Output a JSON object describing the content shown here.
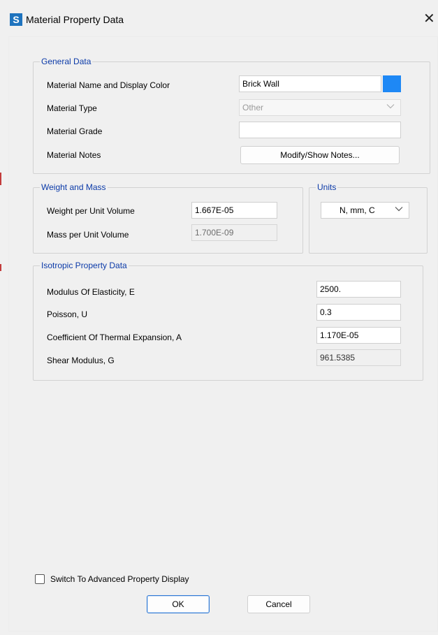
{
  "window": {
    "app_icon_letter": "S",
    "title": "Material Property Data",
    "close_glyph": "✕"
  },
  "general_data": {
    "legend": "General Data",
    "material_name_label": "Material Name and Display Color",
    "material_name_value": "Brick Wall",
    "display_color": "#1e88f5",
    "material_type_label": "Material Type",
    "material_type_value": "Other",
    "material_grade_label": "Material Grade",
    "material_grade_value": "",
    "material_notes_label": "Material Notes",
    "notes_button_label": "Modify/Show Notes..."
  },
  "weight_and_mass": {
    "legend": "Weight and Mass",
    "weight_label": "Weight per Unit Volume",
    "weight_value": "1.667E-05",
    "mass_label": "Mass per Unit Volume",
    "mass_value": "1.700E-09"
  },
  "units": {
    "legend": "Units",
    "value": "N, mm, C"
  },
  "isotropic": {
    "legend": "Isotropic Property Data",
    "modulus_label": "Modulus Of Elasticity,  E",
    "modulus_value": "2500.",
    "poisson_label": "Poisson,  U",
    "poisson_value": "0.3",
    "thermal_label": "Coefficient Of Thermal Expansion,  A",
    "thermal_value": "1.170E-05",
    "shear_label": "Shear Modulus,  G",
    "shear_value": "961.5385"
  },
  "footer": {
    "advanced_checkbox_label": "Switch To Advanced Property Display",
    "advanced_checked": false,
    "ok_label": "OK",
    "cancel_label": "Cancel"
  },
  "colors": {
    "legend_text": "#0b3aa8",
    "app_icon": "#1e73be",
    "default_button_border": "#2e78d4"
  },
  "icons": {
    "app": "app-logo-icon",
    "close": "close-icon",
    "dropdown": "chevron-down-icon"
  }
}
